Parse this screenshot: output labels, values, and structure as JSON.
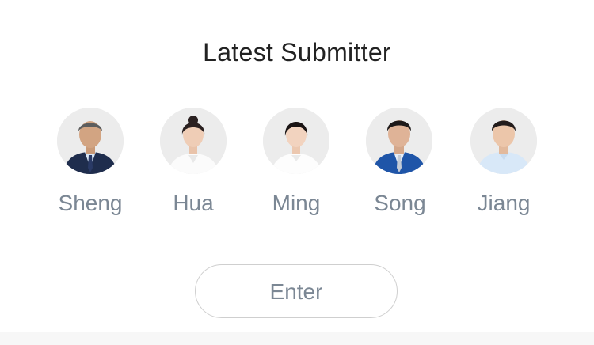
{
  "header": {
    "title": "Latest Submitter"
  },
  "submitters": [
    {
      "name": "Sheng",
      "avatar_icon": "person-avatar-icon"
    },
    {
      "name": "Hua",
      "avatar_icon": "person-avatar-icon"
    },
    {
      "name": "Ming",
      "avatar_icon": "person-avatar-icon"
    },
    {
      "name": "Song",
      "avatar_icon": "person-avatar-icon"
    },
    {
      "name": "Jiang",
      "avatar_icon": "person-avatar-icon"
    }
  ],
  "actions": {
    "enter_label": "Enter"
  },
  "colors": {
    "title": "#222222",
    "muted_text": "#7b8794",
    "avatar_bg": "#ececec",
    "button_border": "#cfcfcf"
  }
}
